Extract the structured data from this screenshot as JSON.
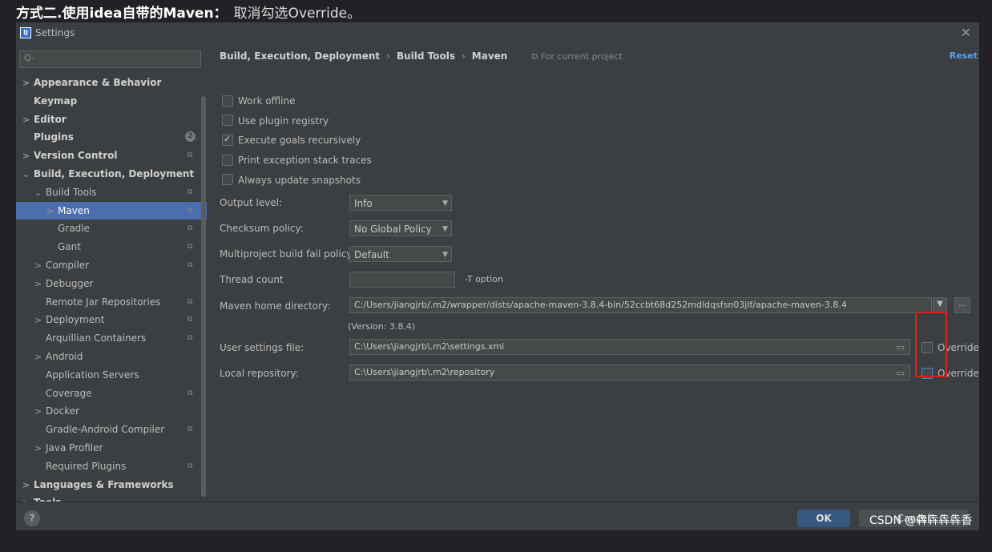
{
  "caption": {
    "bold": "方式二.使用idea自带的Maven：",
    "text": "取消勾选Override。"
  },
  "window": {
    "title": "Settings",
    "logo": "IJ",
    "close_icon": "close-icon"
  },
  "sidebar": {
    "search_placeholder": "Q-",
    "items": [
      {
        "label": "Appearance & Behavior",
        "arrow": ">",
        "bold": true
      },
      {
        "label": "Keymap",
        "arrow": "",
        "bold": true
      },
      {
        "label": "Editor",
        "arrow": ">",
        "bold": true
      },
      {
        "label": "Plugins",
        "arrow": "",
        "bold": true,
        "badge": "2"
      },
      {
        "label": "Version Control",
        "arrow": ">",
        "bold": true,
        "project": true
      },
      {
        "label": "Build, Execution, Deployment",
        "arrow": "⌄",
        "bold": true
      },
      {
        "label": "Build Tools",
        "arrow": "⌄",
        "bold": false,
        "project": true
      },
      {
        "label": "Maven",
        "arrow": ">",
        "bold": false,
        "project": true,
        "selected": true
      },
      {
        "label": "Gradle",
        "arrow": "",
        "bold": false,
        "project": true
      },
      {
        "label": "Gant",
        "arrow": "",
        "bold": false,
        "project": true
      },
      {
        "label": "Compiler",
        "arrow": ">",
        "bold": false,
        "project": true
      },
      {
        "label": "Debugger",
        "arrow": ">",
        "bold": false
      },
      {
        "label": "Remote Jar Repositories",
        "arrow": "",
        "bold": false,
        "project": true
      },
      {
        "label": "Deployment",
        "arrow": ">",
        "bold": false,
        "project": true
      },
      {
        "label": "Arquillian Containers",
        "arrow": "",
        "bold": false,
        "project": true
      },
      {
        "label": "Android",
        "arrow": ">",
        "bold": false
      },
      {
        "label": "Application Servers",
        "arrow": "",
        "bold": false
      },
      {
        "label": "Coverage",
        "arrow": "",
        "bold": false,
        "project": true
      },
      {
        "label": "Docker",
        "arrow": ">",
        "bold": false
      },
      {
        "label": "Gradle-Android Compiler",
        "arrow": "",
        "bold": false,
        "project": true
      },
      {
        "label": "Java Profiler",
        "arrow": ">",
        "bold": false
      },
      {
        "label": "Required Plugins",
        "arrow": "",
        "bold": false,
        "project": true
      },
      {
        "label": "Languages & Frameworks",
        "arrow": ">",
        "bold": true
      },
      {
        "label": "Tools",
        "arrow": ">",
        "bold": true
      }
    ]
  },
  "breadcrumb": {
    "part1": "Build, Execution, Deployment",
    "sep": "›",
    "part2": "Build Tools",
    "part3": "Maven",
    "scope": "For current project"
  },
  "reset_label": "Reset",
  "checkboxes": [
    {
      "label": "Work offline",
      "checked": false
    },
    {
      "label": "Use plugin registry",
      "checked": false
    },
    {
      "label": "Execute goals recursively",
      "checked": true
    },
    {
      "label": "Print exception stack traces",
      "checked": false
    },
    {
      "label": "Always update snapshots",
      "checked": false
    }
  ],
  "fields": {
    "output_level": {
      "label": "Output level:",
      "value": "Info"
    },
    "checksum_policy": {
      "label": "Checksum policy:",
      "value": "No Global Policy"
    },
    "multiproject": {
      "label": "Multiproject build fail policy:",
      "value": "Default"
    },
    "thread_count": {
      "label": "Thread count",
      "value": "",
      "hint": "-T option"
    },
    "maven_home": {
      "label": "Maven home directory:",
      "value": "C:/Users/jiangjrb/.m2/wrapper/dists/apache-maven-3.8.4-bin/52ccbt68d252mdldqsfsn03jlf/apache-maven-3.8.4",
      "browse": "..."
    },
    "version": "(Version: 3.8.4)",
    "user_settings": {
      "label": "User settings file:",
      "value": "C:\\Users\\jiangjrb\\.m2\\settings.xml",
      "override": "Override"
    },
    "local_repo": {
      "label": "Local repository:",
      "value": "C:\\Users\\jiangjrb\\.m2\\repository",
      "override": "Override"
    }
  },
  "footer": {
    "help": "?",
    "ok": "OK",
    "cancel": "Cancel"
  },
  "watermark": "CSDN @犇犇犇犇香"
}
